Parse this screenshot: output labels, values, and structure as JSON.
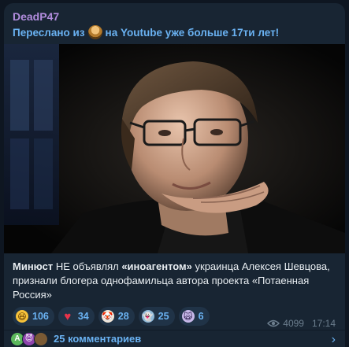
{
  "message": {
    "sender": "DeadP47",
    "forwarded_prefix": "Переслано из",
    "forwarded_source": "на Youtube уже больше 17ти лет!",
    "caption_part1": "Минюст",
    "caption_part2": " НЕ объявлял ",
    "caption_part3": "«иноагентом»",
    "caption_part4": " украинца Алексея Шевцова, признали блогера однофамильца автора проекта «Потаенная Россия»",
    "views": "4099",
    "time": "17:14"
  },
  "reactions": [
    {
      "icon": "laughing-emoji-icon",
      "glyph": "😆",
      "count": "106"
    },
    {
      "icon": "heart-icon",
      "glyph": "♥",
      "count": "34"
    },
    {
      "icon": "clown-icon",
      "glyph": "🤡",
      "count": "28"
    },
    {
      "icon": "ghost-sticker-icon",
      "glyph": "👻",
      "count": "25"
    },
    {
      "icon": "anime-sticker-icon",
      "glyph": "🙀",
      "count": "6"
    }
  ],
  "comments": {
    "label": "25 комментариев",
    "avatar1_letter": "A"
  },
  "colors": {
    "background": "#0e1621",
    "bubble": "#182533",
    "accent": "#6ab2f2",
    "sender": "#b28dde",
    "muted": "#6d7f8f"
  }
}
